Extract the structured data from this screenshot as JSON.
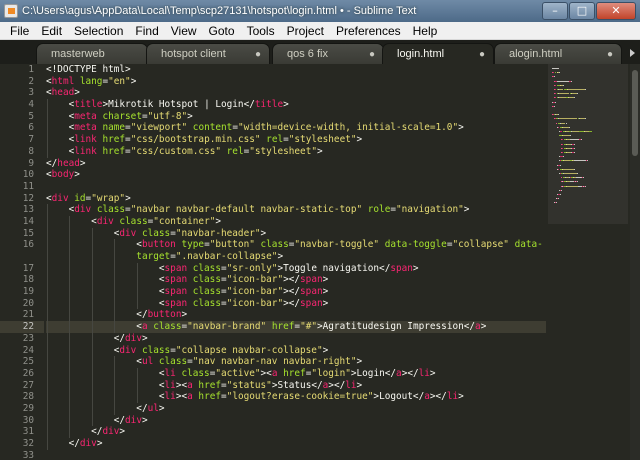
{
  "window": {
    "title": "C:\\Users\\agus\\AppData\\Local\\Temp\\scp27131\\hotspot\\login.html • - Sublime Text",
    "minimize": "–",
    "maximize": "□",
    "close": "✕"
  },
  "menu": [
    "File",
    "Edit",
    "Selection",
    "Find",
    "View",
    "Goto",
    "Tools",
    "Project",
    "Preferences",
    "Help"
  ],
  "tabs": [
    {
      "label": "masterweb",
      "close": "",
      "active": false
    },
    {
      "label": "hotspot client",
      "close": "●",
      "active": false
    },
    {
      "label": "qos 6 fix",
      "close": "●",
      "active": false
    },
    {
      "label": "login.html",
      "close": "●",
      "active": true
    },
    {
      "label": "alogin.html",
      "close": "●",
      "active": false
    }
  ],
  "editor": {
    "current_line": 22,
    "lines": [
      {
        "n": "1",
        "tokens": [
          {
            "t": "<!DOCTYPE html>",
            "c": "pn"
          }
        ]
      },
      {
        "n": "2",
        "tokens": [
          {
            "t": "<",
            "c": "pn"
          },
          {
            "t": "html",
            "c": "tg"
          },
          {
            "t": " lang",
            "c": "at"
          },
          {
            "t": "=",
            "c": "pn"
          },
          {
            "t": "\"en\"",
            "c": "st"
          },
          {
            "t": ">",
            "c": "pn"
          }
        ]
      },
      {
        "n": "3",
        "tokens": [
          {
            "t": "<",
            "c": "pn"
          },
          {
            "t": "head",
            "c": "tg"
          },
          {
            "t": ">",
            "c": "pn"
          }
        ]
      },
      {
        "n": "4",
        "tokens": [
          {
            "t": "    <",
            "c": "pn"
          },
          {
            "t": "title",
            "c": "tg"
          },
          {
            "t": ">Mikrotik Hotspot | Login</",
            "c": "pn"
          },
          {
            "t": "title",
            "c": "tg"
          },
          {
            "t": ">",
            "c": "pn"
          }
        ]
      },
      {
        "n": "5",
        "tokens": [
          {
            "t": "    <",
            "c": "pn"
          },
          {
            "t": "meta",
            "c": "tg"
          },
          {
            "t": " charset",
            "c": "at"
          },
          {
            "t": "=",
            "c": "pn"
          },
          {
            "t": "\"utf-8\"",
            "c": "st"
          },
          {
            "t": ">",
            "c": "pn"
          }
        ]
      },
      {
        "n": "6",
        "tokens": [
          {
            "t": "    <",
            "c": "pn"
          },
          {
            "t": "meta",
            "c": "tg"
          },
          {
            "t": " name",
            "c": "at"
          },
          {
            "t": "=",
            "c": "pn"
          },
          {
            "t": "\"viewport\"",
            "c": "st"
          },
          {
            "t": " content",
            "c": "at"
          },
          {
            "t": "=",
            "c": "pn"
          },
          {
            "t": "\"width=device-width, initial-scale=1.0\"",
            "c": "st"
          },
          {
            "t": ">",
            "c": "pn"
          }
        ]
      },
      {
        "n": "7",
        "tokens": [
          {
            "t": "    <",
            "c": "pn"
          },
          {
            "t": "link",
            "c": "tg"
          },
          {
            "t": " href",
            "c": "at"
          },
          {
            "t": "=",
            "c": "pn"
          },
          {
            "t": "\"css/bootstrap.min.css\"",
            "c": "st"
          },
          {
            "t": " rel",
            "c": "at"
          },
          {
            "t": "=",
            "c": "pn"
          },
          {
            "t": "\"stylesheet\"",
            "c": "st"
          },
          {
            "t": ">",
            "c": "pn"
          }
        ]
      },
      {
        "n": "8",
        "tokens": [
          {
            "t": "    <",
            "c": "pn"
          },
          {
            "t": "link",
            "c": "tg"
          },
          {
            "t": " href",
            "c": "at"
          },
          {
            "t": "=",
            "c": "pn"
          },
          {
            "t": "\"css/custom.css\"",
            "c": "st"
          },
          {
            "t": " rel",
            "c": "at"
          },
          {
            "t": "=",
            "c": "pn"
          },
          {
            "t": "\"stylesheet\"",
            "c": "st"
          },
          {
            "t": ">",
            "c": "pn"
          }
        ]
      },
      {
        "n": "9",
        "tokens": [
          {
            "t": "</",
            "c": "pn"
          },
          {
            "t": "head",
            "c": "tg"
          },
          {
            "t": ">",
            "c": "pn"
          }
        ]
      },
      {
        "n": "10",
        "tokens": [
          {
            "t": "<",
            "c": "pn"
          },
          {
            "t": "body",
            "c": "tg"
          },
          {
            "t": ">",
            "c": "pn"
          }
        ]
      },
      {
        "n": "11",
        "tokens": []
      },
      {
        "n": "12",
        "tokens": [
          {
            "t": "<",
            "c": "pn"
          },
          {
            "t": "div",
            "c": "tg"
          },
          {
            "t": " id",
            "c": "at"
          },
          {
            "t": "=",
            "c": "pn"
          },
          {
            "t": "\"wrap\"",
            "c": "st"
          },
          {
            "t": ">",
            "c": "pn"
          }
        ]
      },
      {
        "n": "13",
        "tokens": [
          {
            "t": "    <",
            "c": "pn"
          },
          {
            "t": "div",
            "c": "tg"
          },
          {
            "t": " class",
            "c": "at"
          },
          {
            "t": "=",
            "c": "pn"
          },
          {
            "t": "\"navbar navbar-default navbar-static-top\"",
            "c": "st"
          },
          {
            "t": " role",
            "c": "at"
          },
          {
            "t": "=",
            "c": "pn"
          },
          {
            "t": "\"navigation\"",
            "c": "st"
          },
          {
            "t": ">",
            "c": "pn"
          }
        ]
      },
      {
        "n": "14",
        "tokens": [
          {
            "t": "        <",
            "c": "pn"
          },
          {
            "t": "div",
            "c": "tg"
          },
          {
            "t": " class",
            "c": "at"
          },
          {
            "t": "=",
            "c": "pn"
          },
          {
            "t": "\"container\"",
            "c": "st"
          },
          {
            "t": ">",
            "c": "pn"
          }
        ]
      },
      {
        "n": "15",
        "tokens": [
          {
            "t": "            <",
            "c": "pn"
          },
          {
            "t": "div",
            "c": "tg"
          },
          {
            "t": " class",
            "c": "at"
          },
          {
            "t": "=",
            "c": "pn"
          },
          {
            "t": "\"navbar-header\"",
            "c": "st"
          },
          {
            "t": ">",
            "c": "pn"
          }
        ]
      },
      {
        "n": "16",
        "tokens": [
          {
            "t": "                <",
            "c": "pn"
          },
          {
            "t": "button",
            "c": "tg"
          },
          {
            "t": " type",
            "c": "at"
          },
          {
            "t": "=",
            "c": "pn"
          },
          {
            "t": "\"button\"",
            "c": "st"
          },
          {
            "t": " class",
            "c": "at"
          },
          {
            "t": "=",
            "c": "pn"
          },
          {
            "t": "\"navbar-toggle\"",
            "c": "st"
          },
          {
            "t": " data-toggle",
            "c": "at"
          },
          {
            "t": "=",
            "c": "pn"
          },
          {
            "t": "\"collapse\"",
            "c": "st"
          },
          {
            "t": " data-",
            "c": "at"
          }
        ]
      },
      {
        "n": "",
        "tokens": [
          {
            "t": "                target",
            "c": "at"
          },
          {
            "t": "=",
            "c": "pn"
          },
          {
            "t": "\".navbar-collapse\"",
            "c": "st"
          },
          {
            "t": ">",
            "c": "pn"
          }
        ]
      },
      {
        "n": "17",
        "tokens": [
          {
            "t": "                    <",
            "c": "pn"
          },
          {
            "t": "span",
            "c": "tg"
          },
          {
            "t": " class",
            "c": "at"
          },
          {
            "t": "=",
            "c": "pn"
          },
          {
            "t": "\"sr-only\"",
            "c": "st"
          },
          {
            "t": ">Toggle navigation</",
            "c": "pn"
          },
          {
            "t": "span",
            "c": "tg"
          },
          {
            "t": ">",
            "c": "pn"
          }
        ]
      },
      {
        "n": "18",
        "tokens": [
          {
            "t": "                    <",
            "c": "pn"
          },
          {
            "t": "span",
            "c": "tg"
          },
          {
            "t": " class",
            "c": "at"
          },
          {
            "t": "=",
            "c": "pn"
          },
          {
            "t": "\"icon-bar\"",
            "c": "st"
          },
          {
            "t": "></",
            "c": "pn"
          },
          {
            "t": "span",
            "c": "tg"
          },
          {
            "t": ">",
            "c": "pn"
          }
        ]
      },
      {
        "n": "19",
        "tokens": [
          {
            "t": "                    <",
            "c": "pn"
          },
          {
            "t": "span",
            "c": "tg"
          },
          {
            "t": " class",
            "c": "at"
          },
          {
            "t": "=",
            "c": "pn"
          },
          {
            "t": "\"icon-bar\"",
            "c": "st"
          },
          {
            "t": "></",
            "c": "pn"
          },
          {
            "t": "span",
            "c": "tg"
          },
          {
            "t": ">",
            "c": "pn"
          }
        ]
      },
      {
        "n": "20",
        "tokens": [
          {
            "t": "                    <",
            "c": "pn"
          },
          {
            "t": "span",
            "c": "tg"
          },
          {
            "t": " class",
            "c": "at"
          },
          {
            "t": "=",
            "c": "pn"
          },
          {
            "t": "\"icon-bar\"",
            "c": "st"
          },
          {
            "t": "></",
            "c": "pn"
          },
          {
            "t": "span",
            "c": "tg"
          },
          {
            "t": ">",
            "c": "pn"
          }
        ]
      },
      {
        "n": "21",
        "tokens": [
          {
            "t": "                </",
            "c": "pn"
          },
          {
            "t": "button",
            "c": "tg"
          },
          {
            "t": ">",
            "c": "pn"
          }
        ]
      },
      {
        "n": "22",
        "tokens": [
          {
            "t": "                <",
            "c": "pn"
          },
          {
            "t": "a",
            "c": "tg"
          },
          {
            "t": " class",
            "c": "at"
          },
          {
            "t": "=",
            "c": "pn"
          },
          {
            "t": "\"navbar-brand\"",
            "c": "st"
          },
          {
            "t": " href",
            "c": "at"
          },
          {
            "t": "=",
            "c": "pn"
          },
          {
            "t": "\"#\"",
            "c": "st"
          },
          {
            "t": ">Agratitudesign Impression</",
            "c": "pn"
          },
          {
            "t": "a",
            "c": "tg"
          },
          {
            "t": ">",
            "c": "pn"
          }
        ]
      },
      {
        "n": "23",
        "tokens": [
          {
            "t": "            </",
            "c": "pn"
          },
          {
            "t": "div",
            "c": "tg"
          },
          {
            "t": ">",
            "c": "pn"
          }
        ]
      },
      {
        "n": "24",
        "tokens": [
          {
            "t": "            <",
            "c": "pn"
          },
          {
            "t": "div",
            "c": "tg"
          },
          {
            "t": " class",
            "c": "at"
          },
          {
            "t": "=",
            "c": "pn"
          },
          {
            "t": "\"collapse navbar-collapse\"",
            "c": "st"
          },
          {
            "t": ">",
            "c": "pn"
          }
        ]
      },
      {
        "n": "25",
        "tokens": [
          {
            "t": "                <",
            "c": "pn"
          },
          {
            "t": "ul",
            "c": "tg"
          },
          {
            "t": " class",
            "c": "at"
          },
          {
            "t": "=",
            "c": "pn"
          },
          {
            "t": "\"nav navbar-nav navbar-right\"",
            "c": "st"
          },
          {
            "t": ">",
            "c": "pn"
          }
        ]
      },
      {
        "n": "26",
        "tokens": [
          {
            "t": "                    <",
            "c": "pn"
          },
          {
            "t": "li",
            "c": "tg"
          },
          {
            "t": " class",
            "c": "at"
          },
          {
            "t": "=",
            "c": "pn"
          },
          {
            "t": "\"active\"",
            "c": "st"
          },
          {
            "t": "><",
            "c": "pn"
          },
          {
            "t": "a",
            "c": "tg"
          },
          {
            "t": " href",
            "c": "at"
          },
          {
            "t": "=",
            "c": "pn"
          },
          {
            "t": "\"login\"",
            "c": "st"
          },
          {
            "t": ">Login</",
            "c": "pn"
          },
          {
            "t": "a",
            "c": "tg"
          },
          {
            "t": "></",
            "c": "pn"
          },
          {
            "t": "li",
            "c": "tg"
          },
          {
            "t": ">",
            "c": "pn"
          }
        ]
      },
      {
        "n": "27",
        "tokens": [
          {
            "t": "                    <",
            "c": "pn"
          },
          {
            "t": "li",
            "c": "tg"
          },
          {
            "t": "><",
            "c": "pn"
          },
          {
            "t": "a",
            "c": "tg"
          },
          {
            "t": " href",
            "c": "at"
          },
          {
            "t": "=",
            "c": "pn"
          },
          {
            "t": "\"status\"",
            "c": "st"
          },
          {
            "t": ">Status</",
            "c": "pn"
          },
          {
            "t": "a",
            "c": "tg"
          },
          {
            "t": "></",
            "c": "pn"
          },
          {
            "t": "li",
            "c": "tg"
          },
          {
            "t": ">",
            "c": "pn"
          }
        ]
      },
      {
        "n": "28",
        "tokens": [
          {
            "t": "                    <",
            "c": "pn"
          },
          {
            "t": "li",
            "c": "tg"
          },
          {
            "t": "><",
            "c": "pn"
          },
          {
            "t": "a",
            "c": "tg"
          },
          {
            "t": " href",
            "c": "at"
          },
          {
            "t": "=",
            "c": "pn"
          },
          {
            "t": "\"logout?erase-cookie=true\"",
            "c": "st"
          },
          {
            "t": ">Logout</",
            "c": "pn"
          },
          {
            "t": "a",
            "c": "tg"
          },
          {
            "t": "></",
            "c": "pn"
          },
          {
            "t": "li",
            "c": "tg"
          },
          {
            "t": ">",
            "c": "pn"
          }
        ]
      },
      {
        "n": "29",
        "tokens": [
          {
            "t": "                </",
            "c": "pn"
          },
          {
            "t": "ul",
            "c": "tg"
          },
          {
            "t": ">",
            "c": "pn"
          }
        ]
      },
      {
        "n": "30",
        "tokens": [
          {
            "t": "            </",
            "c": "pn"
          },
          {
            "t": "div",
            "c": "tg"
          },
          {
            "t": ">",
            "c": "pn"
          }
        ]
      },
      {
        "n": "31",
        "tokens": [
          {
            "t": "        </",
            "c": "pn"
          },
          {
            "t": "div",
            "c": "tg"
          },
          {
            "t": ">",
            "c": "pn"
          }
        ]
      },
      {
        "n": "32",
        "tokens": [
          {
            "t": "    </",
            "c": "pn"
          },
          {
            "t": "div",
            "c": "tg"
          },
          {
            "t": ">",
            "c": "pn"
          }
        ]
      },
      {
        "n": "33",
        "tokens": []
      }
    ]
  },
  "colors": {
    "background": "#272822",
    "tag": "#f92672",
    "attribute": "#a6e22e",
    "string": "#e6db74",
    "text": "#f8f8f2",
    "line_number": "#8f908a"
  }
}
